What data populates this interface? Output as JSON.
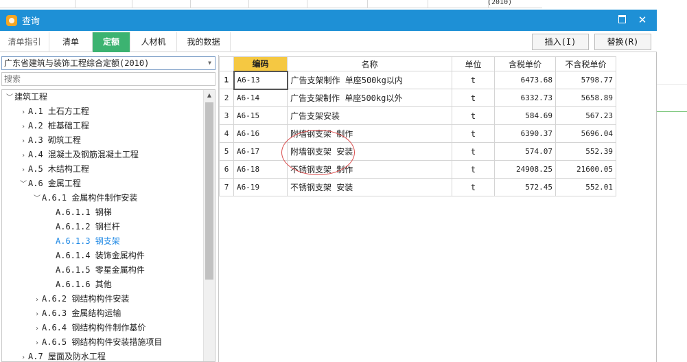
{
  "background": {
    "top_fragment": "(2010)"
  },
  "window": {
    "title": "查询",
    "maximize_icon": "maximize-icon",
    "close_glyph": "✕"
  },
  "tabs": [
    {
      "label": "清单指引",
      "state": "dim"
    },
    {
      "label": "清单",
      "state": "normal"
    },
    {
      "label": "定额",
      "state": "active"
    },
    {
      "label": "人材机",
      "state": "normal"
    },
    {
      "label": "我的数据",
      "state": "normal"
    }
  ],
  "actions": {
    "insert": "插入(I)",
    "replace": "替换(R)"
  },
  "library": {
    "selected": "广东省建筑与装饰工程综合定额(2010)"
  },
  "search": {
    "placeholder": "搜索"
  },
  "tree": [
    {
      "label": "建筑工程",
      "arrow": "﹀",
      "level": 0
    },
    {
      "label": "A.1 土石方工程",
      "arrow": "›",
      "level": 1
    },
    {
      "label": "A.2 桩基础工程",
      "arrow": "›",
      "level": 1
    },
    {
      "label": "A.3 砌筑工程",
      "arrow": "›",
      "level": 1
    },
    {
      "label": "A.4 混凝土及钢筋混凝土工程",
      "arrow": "›",
      "level": 1
    },
    {
      "label": "A.5 木结构工程",
      "arrow": "›",
      "level": 1
    },
    {
      "label": "A.6 金属工程",
      "arrow": "﹀",
      "level": 1
    },
    {
      "label": "A.6.1 金属构件制作安装",
      "arrow": "﹀",
      "level": 2
    },
    {
      "label": "A.6.1.1 钢梯",
      "arrow": "",
      "level": 3
    },
    {
      "label": "A.6.1.2 钢栏杆",
      "arrow": "",
      "level": 3
    },
    {
      "label": "A.6.1.3 钢支架",
      "arrow": "",
      "level": 3,
      "selected": true
    },
    {
      "label": "A.6.1.4 装饰金属构件",
      "arrow": "",
      "level": 3
    },
    {
      "label": "A.6.1.5 零星金属构件",
      "arrow": "",
      "level": 3
    },
    {
      "label": "A.6.1.6 其他",
      "arrow": "",
      "level": 3
    },
    {
      "label": "A.6.2 钢结构构件安装",
      "arrow": "›",
      "level": 2
    },
    {
      "label": "A.6.3 金属结构运输",
      "arrow": "›",
      "level": 2
    },
    {
      "label": "A.6.4 钢结构构件制作基价",
      "arrow": "›",
      "level": 2
    },
    {
      "label": "A.6.5 钢结构构件安装措施项目",
      "arrow": "›",
      "level": 2
    },
    {
      "label": "A.7 屋面及防水工程",
      "arrow": "›",
      "level": 1
    }
  ],
  "grid": {
    "headers": {
      "code": "编码",
      "name": "名称",
      "unit": "单位",
      "tax_price": "含税单价",
      "notax_price": "不含税单价"
    },
    "rows": [
      {
        "n": "1",
        "code": "A6-13",
        "name": "广告支架制作 单座500kg以内",
        "unit": "t",
        "tax": "6473.68",
        "notax": "5798.77"
      },
      {
        "n": "2",
        "code": "A6-14",
        "name": "广告支架制作 单座500kg以外",
        "unit": "t",
        "tax": "6332.73",
        "notax": "5658.89"
      },
      {
        "n": "3",
        "code": "A6-15",
        "name": "广告支架安装",
        "unit": "t",
        "tax": "584.69",
        "notax": "567.23"
      },
      {
        "n": "4",
        "code": "A6-16",
        "name": "附墙钢支架 制作",
        "unit": "t",
        "tax": "6390.37",
        "notax": "5696.04"
      },
      {
        "n": "5",
        "code": "A6-17",
        "name": "附墙钢支架 安装",
        "unit": "t",
        "tax": "574.07",
        "notax": "552.39"
      },
      {
        "n": "6",
        "code": "A6-18",
        "name": "不锈钢支架 制作",
        "unit": "t",
        "tax": "24908.25",
        "notax": "21600.05"
      },
      {
        "n": "7",
        "code": "A6-19",
        "name": "不锈钢支架 安装",
        "unit": "t",
        "tax": "572.45",
        "notax": "552.01"
      }
    ]
  }
}
